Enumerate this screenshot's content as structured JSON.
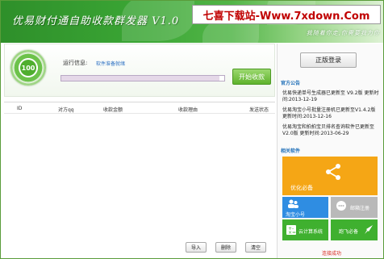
{
  "header": {
    "title": "优易财付通自助收款群发器 V1.0",
    "watermark": "七喜下载站-Www.7xdown.Com",
    "slogan": "我随着你走,你需要我为你"
  },
  "status_panel": {
    "score": "100",
    "run_info_label": "运行信息:",
    "run_info_value": "软件准备就绪",
    "progress_fraction": 0.97,
    "start_button": "开始收款"
  },
  "table": {
    "columns": [
      "ID",
      "对方qq",
      "收款金额",
      "收款理由",
      "发送状态"
    ]
  },
  "bottom_buttons": {
    "import": "导入",
    "delete": "删除",
    "clear": "清空"
  },
  "right_panel": {
    "login_button": "正版登录",
    "notices_title": "官方公告",
    "notices": [
      "优易快递单号生成器已更新至 V9.2版 更新时间:2013-12-19",
      "优易淘宝小号批量注册机已更新至V1.4.2版 更新时间:2013-12-16",
      "优易淘宝和拍拍宝贝排名查询软件已更新至 V2.0版 更新时间:2013-06-29"
    ],
    "software_title": "相关软件",
    "tiles": {
      "optimize": "优化必备",
      "taobao": "淘宝小号",
      "email": "邮箱注册",
      "cloud": "云计算系统",
      "fly": "跑飞必备"
    },
    "status": "连接成功"
  },
  "colors": {
    "header_green": "#3aa534",
    "accent_green": "#5fb32c",
    "notice_blue": "#1f6fb8",
    "tile_orange": "#f5a615",
    "tile_blue": "#2f8de2",
    "tile_gray": "#b9b9b9",
    "tile_green": "#3fb02f",
    "status_red": "#d9281f",
    "watermark_red": "#c00000"
  }
}
